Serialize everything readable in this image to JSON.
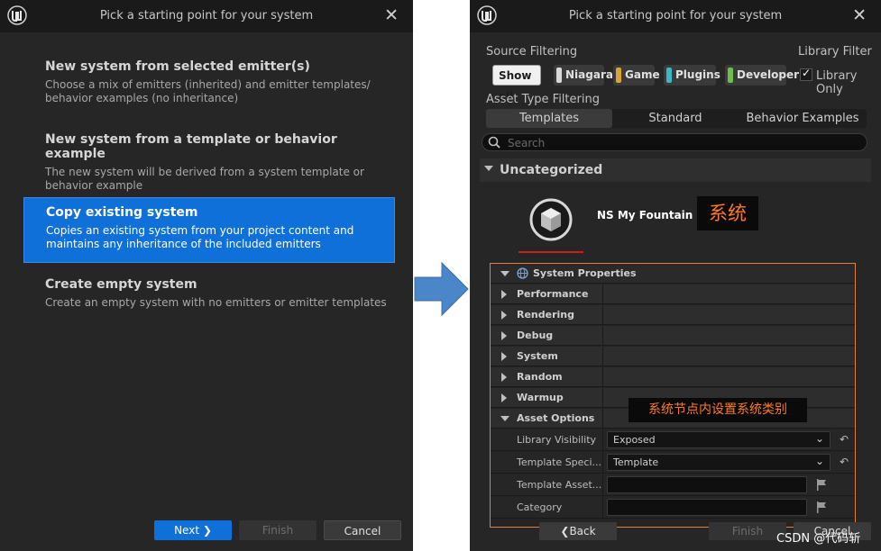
{
  "left_dialog": {
    "title": "Pick a starting point for your system",
    "options": [
      {
        "title": "New system from selected emitter(s)",
        "desc": "Choose a mix of emitters (inherited) and emitter templates/\nbehavior examples (no inheritance)"
      },
      {
        "title": "New system from a template or behavior example",
        "desc": "The new system will be derived from a system template or\nbehavior example"
      },
      {
        "title": "Copy existing system",
        "desc": "Copies an existing system from your project content and\nmaintains any inheritance of the included emitters"
      },
      {
        "title": "Create empty system",
        "desc": "Create an empty system with no emitters or emitter templates"
      }
    ],
    "buttons": {
      "next": "Next",
      "next_arrow": "❯",
      "finish": "Finish",
      "cancel": "Cancel"
    }
  },
  "right_dialog": {
    "title": "Pick a starting point for your system",
    "source_filtering": {
      "label": "Source Filtering",
      "chips": [
        {
          "label": "Show all",
          "color": ""
        },
        {
          "label": "Niagara",
          "color": "#d9d9d9"
        },
        {
          "label": "Game",
          "color": "#d8a436"
        },
        {
          "label": "Plugins",
          "color": "#3bb7c4"
        },
        {
          "label": "Developer",
          "color": "#6bbf4a"
        }
      ]
    },
    "library_filter": {
      "label": "Library Filter",
      "checkbox_label": "Library Only",
      "checked": true
    },
    "asset_type_filtering": {
      "label": "Asset Type Filtering",
      "tabs": [
        "Templates",
        "Standard",
        "Behavior Examples"
      ]
    },
    "search": {
      "placeholder": "Search"
    },
    "category": "Uncategorized",
    "asset": {
      "name": "NS My Fountain"
    },
    "annotation_system": "系统",
    "properties": {
      "header": "System Properties",
      "sections": [
        "Performance",
        "Rendering",
        "Debug",
        "System",
        "Random",
        "Warmup",
        "Asset Options"
      ],
      "asset_options": [
        {
          "label": "Library Visibility",
          "value": "Exposed"
        },
        {
          "label": "Template Speci...",
          "value": "Template"
        },
        {
          "label": "Template Asset...",
          "value": ""
        },
        {
          "label": "Category",
          "value": ""
        }
      ]
    },
    "annotation_category": "系统节点内设置系统类别",
    "buttons": {
      "back": "Back",
      "back_arrow": "❮",
      "finish": "Finish",
      "cancel": "Cancel"
    }
  },
  "watermark": "CSDN @代码斩",
  "colors": {
    "accent": "#0e70d8",
    "annotation": "#ff7a26",
    "arrow": "#4a86c8"
  }
}
